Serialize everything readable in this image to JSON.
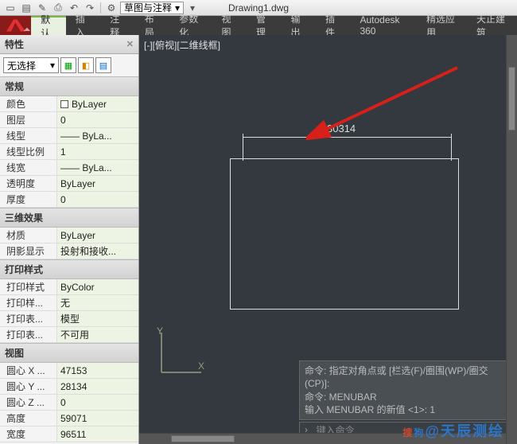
{
  "title": "Drawing1.dwg",
  "workspace": "草图与注释",
  "menu": {
    "tabs": [
      "默认",
      "插入",
      "注释",
      "布局",
      "参数化",
      "视图",
      "管理",
      "输出",
      "插件",
      "Autodesk 360",
      "精选应用",
      "天正建筑"
    ],
    "active_index": 0
  },
  "props_palette": {
    "title": "特性",
    "selection_combo": "无选择",
    "sections": [
      {
        "header": "常规",
        "rows": [
          {
            "label": "颜色",
            "value": "ByLayer",
            "swatch": true
          },
          {
            "label": "图层",
            "value": "0"
          },
          {
            "label": "线型",
            "value": "—— ByLa..."
          },
          {
            "label": "线型比例",
            "value": "1"
          },
          {
            "label": "线宽",
            "value": "—— ByLa..."
          },
          {
            "label": "透明度",
            "value": "ByLayer"
          },
          {
            "label": "厚度",
            "value": "0"
          }
        ]
      },
      {
        "header": "三维效果",
        "rows": [
          {
            "label": "材质",
            "value": "ByLayer"
          },
          {
            "label": "阴影显示",
            "value": "投射和接收..."
          }
        ]
      },
      {
        "header": "打印样式",
        "rows": [
          {
            "label": "打印样式",
            "value": "ByColor"
          },
          {
            "label": "打印样...",
            "value": "无"
          },
          {
            "label": "打印表...",
            "value": "模型"
          },
          {
            "label": "打印表...",
            "value": "不可用"
          }
        ]
      },
      {
        "header": "视图",
        "rows": [
          {
            "label": "圆心 X ...",
            "value": "47153"
          },
          {
            "label": "圆心 Y ...",
            "value": "28134"
          },
          {
            "label": "圆心 Z ...",
            "value": "0"
          },
          {
            "label": "高度",
            "value": "59071"
          },
          {
            "label": "宽度",
            "value": "96511"
          }
        ]
      }
    ]
  },
  "viewport": {
    "label": "[-][俯视][二维线框]",
    "dimension_text": "30314",
    "ucs": {
      "x": "X",
      "y": "Y"
    }
  },
  "command": {
    "lines": [
      "命令: 指定对角点或 [栏选(F)/圈围(WP)/圈交(CP)]:",
      "命令: MENUBAR",
      "输入 MENUBAR 的新值 <1>: 1"
    ],
    "prompt_placeholder": "键入命令"
  },
  "watermark": {
    "a": "搜",
    "b": "狗",
    "c": "@天辰测绘"
  }
}
